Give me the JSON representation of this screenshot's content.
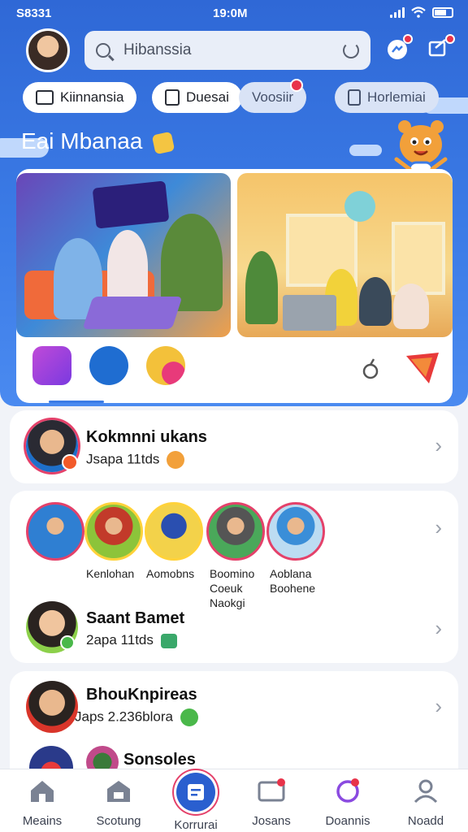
{
  "status_bar": {
    "carrier": "S8331",
    "time": "19:0M"
  },
  "search": {
    "placeholder": "Hibanssia"
  },
  "chips": [
    {
      "label": "Kiinnansia"
    },
    {
      "label": "Duesai"
    },
    {
      "label": "Voosiir"
    },
    {
      "label": "Horlemiai"
    }
  ],
  "section": {
    "title": "Eai Mbanaa"
  },
  "conversations": [
    {
      "name": "Kokmnni ukans",
      "sub": "Jsapa 11tds"
    }
  ],
  "stories": [
    {
      "label": "Kenlohan"
    },
    {
      "label": "Aomobns"
    },
    {
      "label": "Boomino Coeuk Naokgi"
    },
    {
      "label": "Aoblana Boohene"
    }
  ],
  "conversations2": [
    {
      "name": "Saant Bamet",
      "sub": "2apa 11tds"
    },
    {
      "name": "BhouKnpireas",
      "sub": "Japs 2.236blora"
    },
    {
      "name": "Sonsoles"
    }
  ],
  "tabs": [
    {
      "label": "Meains"
    },
    {
      "label": "Scotung"
    },
    {
      "label": "Korrurai"
    },
    {
      "label": "Josans"
    },
    {
      "label": "Doannis"
    },
    {
      "label": "Noadd"
    }
  ],
  "colors": {
    "brand": "#2f68d6",
    "badge": "#e8334a",
    "active_ring": "#e4416a"
  }
}
